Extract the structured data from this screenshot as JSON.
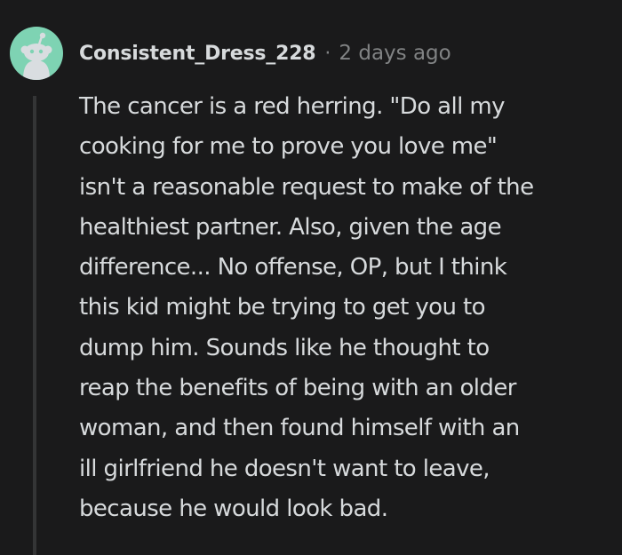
{
  "comment": {
    "username": "Consistent_Dress_228",
    "separator": "·",
    "timestamp": "2 days ago",
    "avatar": "snoo-avatar-icon",
    "body_lines": [
      "The cancer is a red herring. \"Do all my",
      "cooking for me to prove you love me\"",
      "isn't a reasonable request to make of the",
      "healthiest partner. Also, given the age",
      "difference... No offense, OP, but I think",
      "this kid might be trying to get you to",
      "dump him. Sounds like he thought to",
      "reap the benefits of being with an older",
      "woman, and then found himself with an",
      "ill girlfriend he doesn't want to leave,",
      "because he would look bad."
    ]
  },
  "colors": {
    "background": "#1a1a1b",
    "text": "#d7dadc",
    "meta": "#818384",
    "avatar_bg": "#7ed3b3",
    "thread_line": "#343536"
  }
}
